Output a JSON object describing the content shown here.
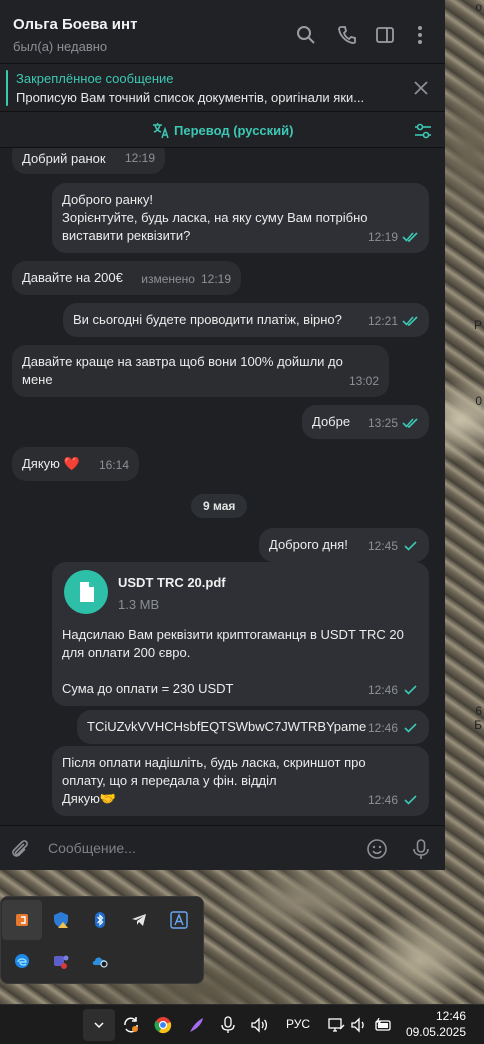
{
  "chat": {
    "name": "Ольга Боева инт",
    "status": "был(а) недавно"
  },
  "pinned": {
    "title": "Закреплённое сообщение",
    "text": "Прописую Вам точний список документів, оригінали яки..."
  },
  "translate": {
    "label": "Перевод (русский)"
  },
  "messages": [
    {
      "text": "Добрий ранок",
      "time": "12:19",
      "direction": "in"
    },
    {
      "text": "Доброго ранку!\nЗорієнтуйте, будь ласка, на яку суму Вам потрібно\nвиставити реквізити?",
      "time": "12:19",
      "direction": "out",
      "status": "read"
    },
    {
      "text": "Давайте на 200€",
      "edited": "изменено",
      "time": "12:19",
      "direction": "in"
    },
    {
      "text": "Ви сьогодні будете проводити платіж, вірно?",
      "time": "12:21",
      "direction": "out",
      "status": "read"
    },
    {
      "text": "Давайте краще на завтра щоб вони 100% дойшли до\nмене",
      "time": "13:02",
      "direction": "in"
    },
    {
      "text": "Добре",
      "time": "13:25",
      "direction": "out",
      "status": "read"
    },
    {
      "text": "Дякую ❤️",
      "time": "16:14",
      "direction": "in"
    },
    {
      "text": "Доброго дня!",
      "time": "12:45",
      "direction": "out",
      "status": "sent"
    },
    {
      "text": "Надсилаю Вам реквізити криптогаманця  в USDT TRC 20\nдля оплати 200 євро.\n\nСума до оплати = 230 USDT",
      "time": "12:46",
      "direction": "out",
      "status": "sent"
    },
    {
      "text": "TCiUZvkVVHCHsbfEQTSWbwC7JWTRBYpame",
      "time": "12:46",
      "direction": "out",
      "status": "sent"
    },
    {
      "text": "Після оплати надішліть, будь ласка, скриншот про\nоплату, що  я передала у фін. відділ\nДякую🤝",
      "time": "12:46",
      "direction": "out",
      "status": "sent"
    }
  ],
  "date_separator": "9 мая",
  "file": {
    "name": "USDT TRC 20.pdf",
    "size": "1.3 MB"
  },
  "composer": {
    "placeholder": "Сообщение..."
  },
  "taskbar": {
    "language": "РУС",
    "time": "12:46",
    "date": "09.05.2025"
  },
  "wall_edge_texts": [
    "о",
    "Р",
    "0",
    "6",
    "Б"
  ],
  "colors": {
    "accent": "#3cc8b4",
    "chat_bg": "#1e2023",
    "bubble": "#2b2d31",
    "read_check": "#3cc8b4"
  },
  "icons": {
    "header": [
      "search-icon",
      "phone-icon",
      "sidebar-icon",
      "more-icon"
    ],
    "tray": [
      "office-icon",
      "security-warning-icon",
      "bluetooth-icon",
      "telegram-icon",
      "translate-app-icon",
      "edge-icon",
      "teams-icon",
      "onedrive-icon"
    ]
  }
}
